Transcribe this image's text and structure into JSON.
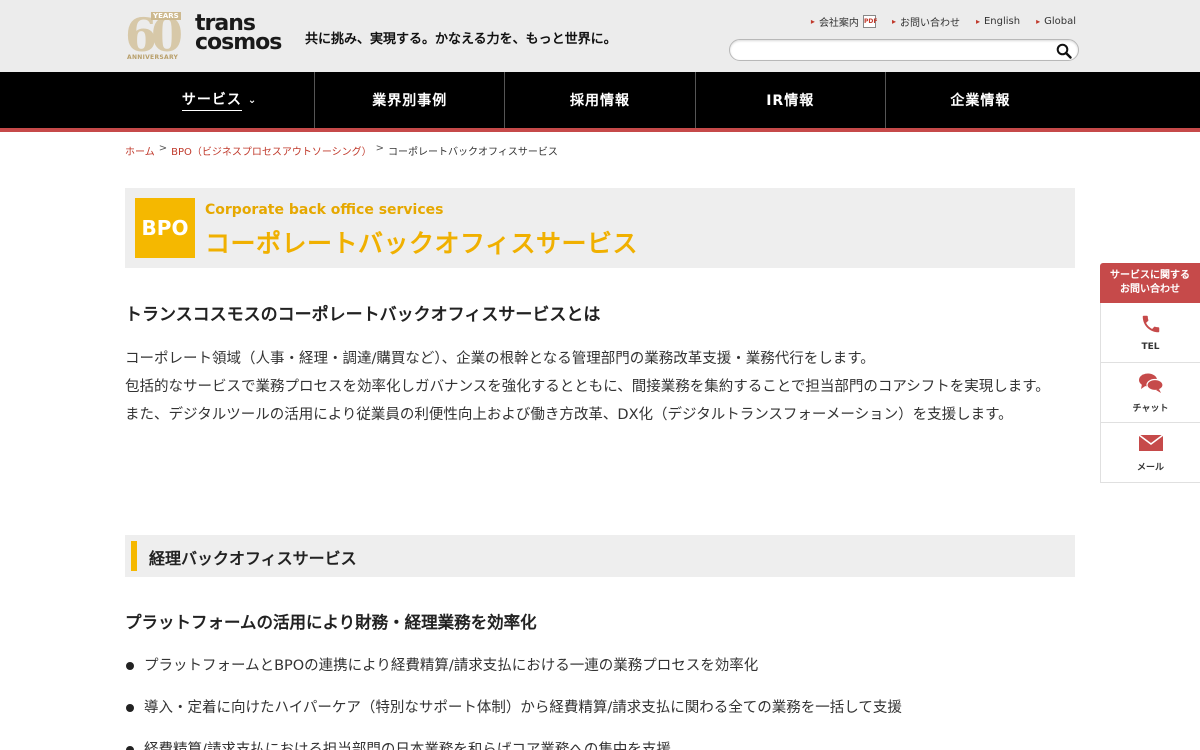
{
  "header": {
    "anniversary": {
      "number": "60",
      "years": "YEARS",
      "label": "ANNIVERSARY"
    },
    "brand_line1": "trans",
    "brand_line2": "cosmos",
    "tagline": "共に挑み、実現する。かなえる力を、もっと世界に。",
    "util_links": [
      {
        "label": "会社案内"
      },
      {
        "label": "お問い合わせ"
      },
      {
        "label": "English"
      },
      {
        "label": "Global"
      }
    ],
    "pdf_icon_label": "PDF",
    "search": {
      "placeholder": "",
      "value": ""
    }
  },
  "nav": {
    "items": [
      {
        "label": "サービス"
      },
      {
        "label": "業界別事例"
      },
      {
        "label": "採用情報"
      },
      {
        "label": "IR情報"
      },
      {
        "label": "企業情報"
      }
    ]
  },
  "breadcrumb": {
    "home": "ホーム",
    "bpo": "BPO（ビジネスプロセスアウトソーシング）",
    "current": "コーポレートバックオフィスサービス",
    "sep": ">"
  },
  "title": {
    "badge": "BPO",
    "en": "Corporate back office services",
    "ja": "コーポレートバックオフィスサービス"
  },
  "main": {
    "heading": "トランスコスモスのコーポレートバックオフィスサービスとは",
    "intro": [
      "コーポレート領域（人事・経理・調達/購買など）、企業の根幹となる管理部門の業務改革支援・業務代行をします。",
      "包括的なサービスで業務プロセスを効率化しガバナンスを強化するとともに、間接業務を集約することで担当部門のコアシフトを実現します。",
      "また、デジタルツールの活用により従業員の利便性向上および働き方改革、DX化（デジタルトランスフォーメーション）を支援します。"
    ],
    "section": "経理バックオフィスサービス",
    "subheading": "プラットフォームの活用により財務・経理業務を効率化",
    "bullets": [
      "プラットフォームとBPOの連携により経費精算/請求支払における一連の業務プロセスを効率化",
      "導入・定着に向けたハイパーケア（特別なサポート体制）から経費精算/請求支払に関わる全ての業務を一括して支援",
      "経費精算/請求支払における担当部門の日本業務を和らげコア業務への集中を支援"
    ]
  },
  "side": {
    "head_line1": "サービスに関する",
    "head_line2": "お問い合わせ",
    "items": [
      {
        "label": "TEL",
        "icon": "phone-icon"
      },
      {
        "label": "チャット",
        "icon": "chat-icon"
      },
      {
        "label": "メール",
        "icon": "mail-icon"
      }
    ]
  },
  "colors": {
    "accent_red": "#c64a4a",
    "accent_yellow": "#f5b800",
    "nav_bg": "#000000"
  }
}
